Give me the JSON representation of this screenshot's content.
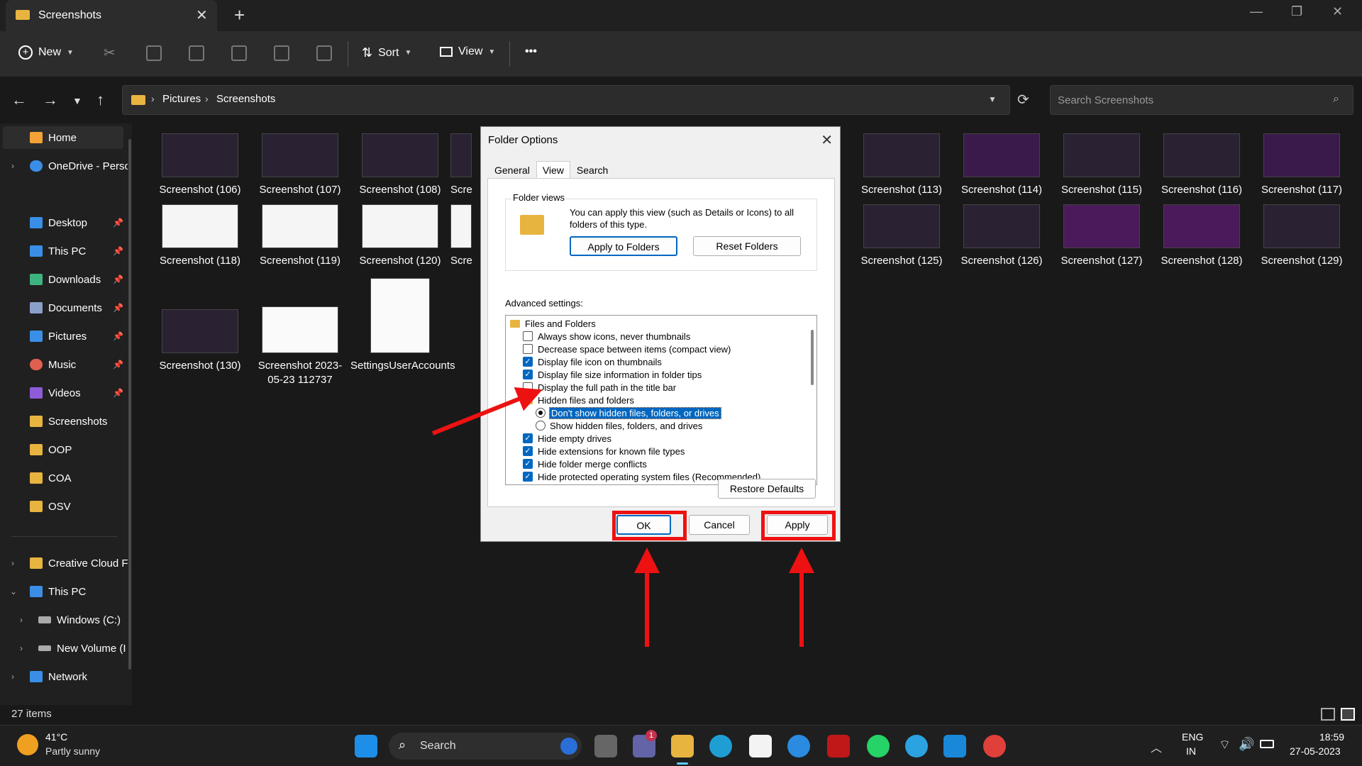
{
  "window": {
    "tab_title": "Screenshots",
    "tab_close": "✕",
    "new_tab": "+",
    "minimize": "—",
    "maximize": "❐",
    "close": "✕"
  },
  "toolbar": {
    "new_label": "New",
    "sort_label": "Sort",
    "view_label": "View",
    "more_label": "•••"
  },
  "address": {
    "segments": [
      "Pictures",
      "Screenshots"
    ],
    "search_placeholder": "Search Screenshots"
  },
  "sidebar": {
    "items": [
      {
        "label": "Home",
        "icon": "home-icon",
        "color": "#f4a236"
      },
      {
        "label": "OneDrive - Perso",
        "icon": "cloud-icon",
        "color": "#3a8ee6"
      },
      {
        "label": "Desktop",
        "icon": "desktop-icon",
        "color": "#3a8ee6"
      },
      {
        "label": "This PC",
        "icon": "pc-icon",
        "color": "#3a8ee6"
      },
      {
        "label": "Downloads",
        "icon": "download-icon",
        "color": "#3fb37f"
      },
      {
        "label": "Documents",
        "icon": "document-icon",
        "color": "#8aa0c8"
      },
      {
        "label": "Pictures",
        "icon": "pictures-icon",
        "color": "#3a8ee6"
      },
      {
        "label": "Music",
        "icon": "music-icon",
        "color": "#e0604f"
      },
      {
        "label": "Videos",
        "icon": "videos-icon",
        "color": "#8e5cd9"
      },
      {
        "label": "Screenshots",
        "icon": "folder-icon",
        "color": "#e8b440"
      },
      {
        "label": "OOP",
        "icon": "folder-icon",
        "color": "#e8b440"
      },
      {
        "label": "COA",
        "icon": "folder-icon",
        "color": "#e8b440"
      },
      {
        "label": "OSV",
        "icon": "folder-icon",
        "color": "#e8b440"
      },
      {
        "label": "Creative Cloud F",
        "icon": "creative-cloud-icon",
        "color": "#e8b440"
      },
      {
        "label": "This PC",
        "icon": "pc-icon",
        "color": "#3a8ee6"
      },
      {
        "label": "Windows (C:)",
        "icon": "drive-icon",
        "color": "#aaaaaa"
      },
      {
        "label": "New Volume (I",
        "icon": "drive-icon",
        "color": "#aaaaaa"
      },
      {
        "label": "Network",
        "icon": "network-icon",
        "color": "#3a8ee6"
      }
    ]
  },
  "files": [
    "Screenshot (106)",
    "Screenshot (107)",
    "Screenshot (108)",
    "Scre",
    "Screenshot (113)",
    "Screenshot (114)",
    "Screenshot (115)",
    "Screenshot (116)",
    "Screenshot (117)",
    "Screenshot (118)",
    "Screenshot (119)",
    "Screenshot (120)",
    "Scre",
    "Screenshot (125)",
    "Screenshot (126)",
    "Screenshot (127)",
    "Screenshot (128)",
    "Screenshot (129)",
    "Screenshot (130)",
    "Screenshot 2023-05-23 112737",
    "SettingsUserAccounts"
  ],
  "status": {
    "item_count": "27 items"
  },
  "dialog": {
    "title": "Folder Options",
    "tabs": [
      "General",
      "View",
      "Search"
    ],
    "folder_views_label": "Folder views",
    "folder_views_text": "You can apply this view (such as Details or Icons) to all folders of this type.",
    "apply_to_folders": "Apply to Folders",
    "reset_folders": "Reset Folders",
    "advanced_label": "Advanced settings:",
    "tree": [
      {
        "type": "folder",
        "label": "Files and Folders"
      },
      {
        "type": "check",
        "checked": false,
        "label": "Always show icons, never thumbnails"
      },
      {
        "type": "check",
        "checked": false,
        "label": "Decrease space between items (compact view)"
      },
      {
        "type": "check",
        "checked": true,
        "label": "Display file icon on thumbnails"
      },
      {
        "type": "check",
        "checked": true,
        "label": "Display file size information in folder tips"
      },
      {
        "type": "check",
        "checked": false,
        "label": "Display the full path in the title bar"
      },
      {
        "type": "folder",
        "label": "Hidden files and folders"
      },
      {
        "type": "radio",
        "checked": true,
        "label": "Don't show hidden files, folders, or drives"
      },
      {
        "type": "radio",
        "checked": false,
        "label": "Show hidden files, folders, and drives"
      },
      {
        "type": "check",
        "checked": true,
        "label": "Hide empty drives"
      },
      {
        "type": "check",
        "checked": true,
        "label": "Hide extensions for known file types"
      },
      {
        "type": "check",
        "checked": true,
        "label": "Hide folder merge conflicts"
      },
      {
        "type": "check",
        "checked": true,
        "label": "Hide protected operating system files (Recommended)"
      }
    ],
    "restore_defaults": "Restore Defaults",
    "ok": "OK",
    "cancel": "Cancel",
    "apply": "Apply"
  },
  "taskbar": {
    "weather_temp": "41°C",
    "weather_text": "Partly sunny",
    "search_label": "Search",
    "lang_line1": "ENG",
    "lang_line2": "IN",
    "time": "18:59",
    "date": "27-05-2023",
    "chat_badge": "1"
  },
  "colors": {
    "accent": "#0067c0",
    "annotation": "#ee1111"
  }
}
